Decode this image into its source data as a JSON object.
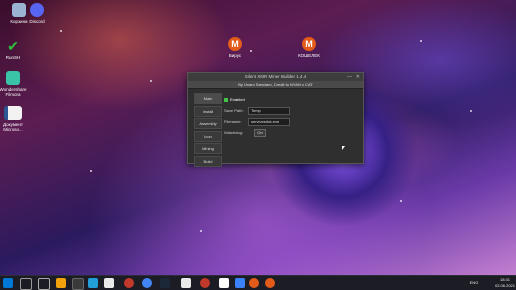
{
  "desktop": {
    "icons": [
      {
        "label": "Корзина",
        "color": "#9ab3d2"
      },
      {
        "label": "Discord",
        "color": "#5865f2"
      },
      {
        "label": "RunSH",
        "color": "#2fbf3b"
      },
      {
        "label": "Wondershare Filmora",
        "color": "#3bc3a8"
      },
      {
        "label": "Документ Microso...",
        "color": "#2b5797"
      },
      {
        "label": "Бирус",
        "color": "#e35b1a"
      },
      {
        "label": "КОШЕЛЕК",
        "color": "#e35b1a"
      }
    ]
  },
  "window": {
    "title": "Silent XMR Miner Builder 1.4.4",
    "subtitle": "By Unam Sanctam, Credit to NYAN x CAT",
    "minimize": "—",
    "close": "✕",
    "sidebar": [
      "Main",
      "Install",
      "Assembly",
      "Icon",
      "Mining",
      "Build"
    ],
    "enabled_label": "Enabled",
    "save_path_label": "Save Path:",
    "save_path_value": "Temp",
    "filename_label": "Filename:",
    "filename_value": "servicestick.exe",
    "watchdog_label": "Watchdog:",
    "watchdog_value": "On"
  },
  "taskbar": {
    "tray_lang": "ENG",
    "time": "18:31",
    "date": "02.06.2021",
    "colors": [
      "#0078d7",
      "#f0a30a",
      "#c0392b",
      "#229ed9",
      "#e9e9e9",
      "#1b2838",
      "#c0392b",
      "#ffffff",
      "#3b82f6",
      "#c0392b",
      "#e35b1a"
    ]
  }
}
